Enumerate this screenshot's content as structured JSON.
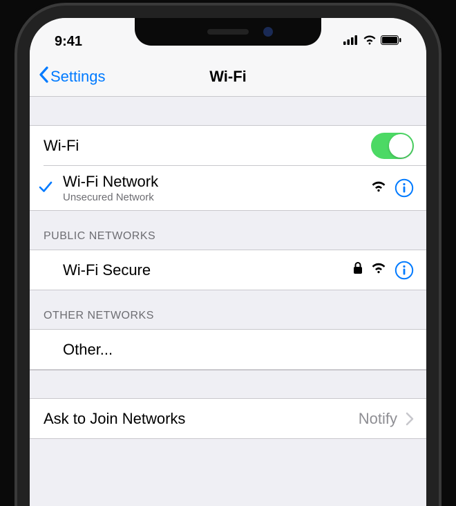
{
  "status_bar": {
    "time": "9:41"
  },
  "nav": {
    "back_label": "Settings",
    "title": "Wi-Fi"
  },
  "cells": {
    "wifi_toggle": {
      "label": "Wi-Fi",
      "on": true
    },
    "connected": {
      "name": "Wi-Fi Network",
      "subtitle": "Unsecured Network"
    },
    "public_header": "PUBLIC NETWORKS",
    "public_network": {
      "name": "Wi-Fi Secure"
    },
    "other_header": "OTHER NETWORKS",
    "other_label": "Other...",
    "ask_join": {
      "label": "Ask to Join Networks",
      "value": "Notify"
    }
  }
}
